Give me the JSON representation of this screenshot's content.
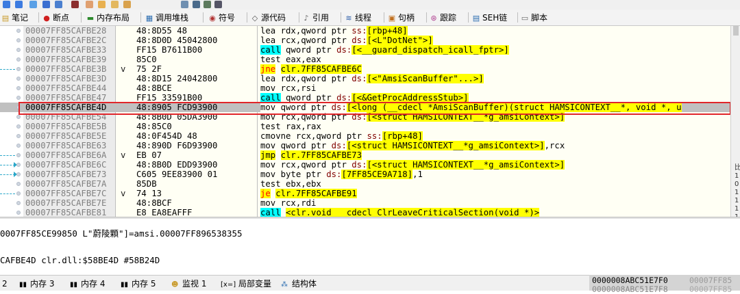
{
  "toolbar_icons": [
    "arrow-right-icon",
    "arrow-down-icon",
    "step-into-icon",
    "step-over-icon",
    "run-to-icon",
    "stop-icon",
    "pen-icon",
    "pencil-icon",
    "brush-icon",
    "patch-icon",
    "fx-icon",
    "hash-icon",
    "font-icon",
    "list-icon",
    "memory-icon",
    "grid-icon",
    "chip-icon"
  ],
  "tabs": [
    {
      "label": "笔记",
      "icon": "notes-icon"
    },
    {
      "label": "断点",
      "icon": "breakpoint-icon"
    },
    {
      "label": "内存布局",
      "icon": "memory-map-icon"
    },
    {
      "label": "调用堆栈",
      "icon": "call-stack-icon"
    },
    {
      "label": "符号",
      "icon": "symbols-icon"
    },
    {
      "label": "源代码",
      "icon": "source-icon"
    },
    {
      "label": "引用",
      "icon": "references-icon"
    },
    {
      "label": "线程",
      "icon": "threads-icon"
    },
    {
      "label": "句柄",
      "icon": "handles-icon"
    },
    {
      "label": "跟踪",
      "icon": "trace-icon"
    },
    {
      "label": "SEH链",
      "icon": "seh-icon"
    },
    {
      "label": "脚本",
      "icon": "script-icon"
    }
  ],
  "disasm": [
    {
      "addr": "00007FF85CAFBE28",
      "bytes": "48:8D55 48",
      "mark": ""
    },
    {
      "addr": "00007FF85CAFBE2C",
      "bytes": "48:8D0D 45042800",
      "mark": ""
    },
    {
      "addr": "00007FF85CAFBE33",
      "bytes": "FF15 B7611B00",
      "mark": ""
    },
    {
      "addr": "00007FF85CAFBE39",
      "bytes": "85C0",
      "mark": ""
    },
    {
      "addr": "00007FF85CAFBE3B",
      "bytes": "75 2F",
      "mark": "v"
    },
    {
      "addr": "00007FF85CAFBE3D",
      "bytes": "48:8D15 24042800",
      "mark": ""
    },
    {
      "addr": "00007FF85CAFBE44",
      "bytes": "48:8BCE",
      "mark": ""
    },
    {
      "addr": "00007FF85CAFBE47",
      "bytes": "FF15 33591B00",
      "mark": ""
    },
    {
      "addr": "00007FF85CAFBE4D",
      "bytes": "48:8905 FCD93900",
      "mark": ""
    },
    {
      "addr": "00007FF85CAFBE54",
      "bytes": "48:8B0D 05DA3900",
      "mark": ""
    },
    {
      "addr": "00007FF85CAFBE5B",
      "bytes": "48:85C0",
      "mark": ""
    },
    {
      "addr": "00007FF85CAFBE5E",
      "bytes": "48:0F454D 48",
      "mark": ""
    },
    {
      "addr": "00007FF85CAFBE63",
      "bytes": "48:890D F6D93900",
      "mark": ""
    },
    {
      "addr": "00007FF85CAFBE6A",
      "bytes": "EB 07",
      "mark": "v"
    },
    {
      "addr": "00007FF85CAFBE6C",
      "bytes": "48:8B0D EDD93900",
      "mark": ""
    },
    {
      "addr": "00007FF85CAFBE73",
      "bytes": "C605 9EE83900 01",
      "mark": ""
    },
    {
      "addr": "00007FF85CAFBE7A",
      "bytes": "85DB",
      "mark": ""
    },
    {
      "addr": "00007FF85CAFBE7C",
      "bytes": "74 13",
      "mark": "v"
    },
    {
      "addr": "00007FF85CAFBE7E",
      "bytes": "48:8BCF",
      "mark": ""
    },
    {
      "addr": "00007FF85CAFBE81",
      "bytes": "E8 EA8EAFFF",
      "mark": ""
    }
  ],
  "instr": {
    "r0": {
      "a": "lea rdx,qword ptr ",
      "b": "ss:",
      "c": "[rbp+48]"
    },
    "r1": {
      "a": "lea rcx,qword ptr ",
      "b": "ds:",
      "c": "[<L\"DotNet\">]"
    },
    "r2": {
      "a": "call",
      "b": " qword ptr ",
      "c": "ds:",
      "d": "[<__guard_dispatch_icall_fptr>]"
    },
    "r3": {
      "a": "test eax,eax"
    },
    "r4": {
      "a": "jne",
      "b": " ",
      "c": "clr.7FF85CAFBE6C"
    },
    "r5": {
      "a": "lea rdx,qword ptr ",
      "b": "ds:",
      "c": "[<\"AmsiScanBuffer\"...>]"
    },
    "r6": {
      "a": "mov rcx,rsi"
    },
    "r7": {
      "a": "call",
      "b": " qword ptr ",
      "c": "ds:",
      "d": "[<&GetProcAddressStub>]"
    },
    "r8": {
      "a": "mov qword ptr ",
      "b": "ds:",
      "c": "[<long (__cdecl *AmsiScanBuffer)(struct HAMSICONTEXT__*, void *, u"
    },
    "r9": {
      "a": "mov rcx,qword ptr ",
      "b": "ds:",
      "c": "[<struct HAMSICONTEXT__*g_amsiContext>]"
    },
    "r10": {
      "a": "test rax,rax"
    },
    "r11": {
      "a": "cmovne rcx,qword ptr ",
      "b": "ss:",
      "c": "[rbp+48]"
    },
    "r12": {
      "a": "mov qword ptr ",
      "b": "ds:",
      "c": "[<struct HAMSICONTEXT__*g_amsiContext>]",
      "d": ",rcx"
    },
    "r13": {
      "a": "jmp",
      "b": " ",
      "c": "clr.7FF85CAFBE73"
    },
    "r14": {
      "a": "mov rcx,qword ptr ",
      "b": "ds:",
      "c": "[<struct HAMSICONTEXT__*g_amsiContext>]"
    },
    "r15": {
      "a": "mov byte ptr ",
      "b": "ds:",
      "c": "[7FF85CE9A718]",
      "d": ",1"
    },
    "r16": {
      "a": "test ebx,ebx"
    },
    "r17": {
      "a": "je",
      "b": " ",
      "c": "clr.7FF85CAFBE91"
    },
    "r18": {
      "a": "mov rcx,rdi"
    },
    "r19": {
      "a": "call",
      "b": " ",
      "c": "<clr.void __cdecl ClrLeaveCriticalSection(void *)>"
    }
  },
  "info": {
    "line1": "0007FF85CE99850 L\"蔚陵顆\"]=amsi.00007FF896538355",
    "line2": "CAFBE4D clr.dll:$58BE4D #58B24D"
  },
  "bottom_tabs": [
    {
      "label": "2",
      "icon": ""
    },
    {
      "label": "内存 3",
      "icon": "memory-icon"
    },
    {
      "label": "内存 4",
      "icon": "memory-icon"
    },
    {
      "label": "内存 5",
      "icon": "memory-icon"
    },
    {
      "label": "监视 1",
      "icon": "watch-icon"
    },
    {
      "label": "局部变量",
      "icon": "locals-icon"
    },
    {
      "label": "结构体",
      "icon": "struct-icon"
    }
  ],
  "memory_address": {
    "selected": "0000008ABC51E7F0",
    "next": "00007FF85",
    "selected2": "0000008ABC51E7F8",
    "next2": "00007FF85"
  },
  "right_side": "比\n1\n0\n1\n1\n1\n1"
}
